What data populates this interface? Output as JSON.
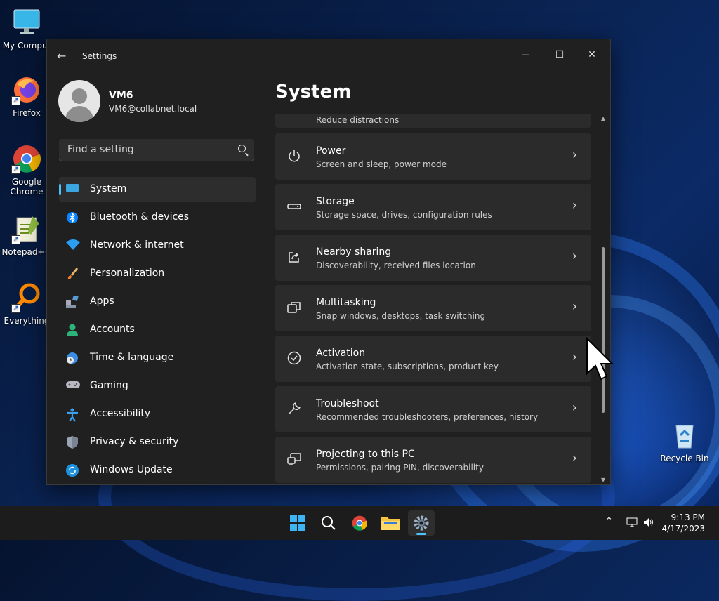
{
  "desktop": {
    "icons": [
      {
        "label": "My Comput"
      },
      {
        "label": "Firefox"
      },
      {
        "label": "Google Chrome"
      },
      {
        "label": "Notepad++"
      },
      {
        "label": "Everything"
      },
      {
        "label": "Recycle Bin"
      }
    ]
  },
  "window": {
    "title": "Settings",
    "back_icon": "←",
    "minimize_icon": "—",
    "maximize_icon": "☐",
    "close_icon": "✕"
  },
  "profile": {
    "name": "VM6",
    "email": "VM6@collabnet.local"
  },
  "search": {
    "placeholder": "Find a setting"
  },
  "nav": {
    "items": [
      {
        "label": "System",
        "icon": "system-icon",
        "active": true
      },
      {
        "label": "Bluetooth & devices",
        "icon": "bluetooth-icon"
      },
      {
        "label": "Network & internet",
        "icon": "wifi-icon"
      },
      {
        "label": "Personalization",
        "icon": "brush-icon"
      },
      {
        "label": "Apps",
        "icon": "apps-icon"
      },
      {
        "label": "Accounts",
        "icon": "person-icon"
      },
      {
        "label": "Time & language",
        "icon": "globe-clock-icon"
      },
      {
        "label": "Gaming",
        "icon": "gamepad-icon"
      },
      {
        "label": "Accessibility",
        "icon": "accessibility-icon"
      },
      {
        "label": "Privacy & security",
        "icon": "shield-icon"
      },
      {
        "label": "Windows Update",
        "icon": "update-icon"
      }
    ]
  },
  "main": {
    "title": "System",
    "partial_card_sub": "Reduce distractions",
    "cards": [
      {
        "title": "Power",
        "sub": "Screen and sleep, power mode",
        "icon": "power-icon"
      },
      {
        "title": "Storage",
        "sub": "Storage space, drives, configuration rules",
        "icon": "storage-icon"
      },
      {
        "title": "Nearby sharing",
        "sub": "Discoverability, received files location",
        "icon": "share-icon"
      },
      {
        "title": "Multitasking",
        "sub": "Snap windows, desktops, task switching",
        "icon": "multitasking-icon"
      },
      {
        "title": "Activation",
        "sub": "Activation state, subscriptions, product key",
        "icon": "checkmark-circle-icon"
      },
      {
        "title": "Troubleshoot",
        "sub": "Recommended troubleshooters, preferences, history",
        "icon": "wrench-icon"
      },
      {
        "title": "Projecting to this PC",
        "sub": "Permissions, pairing PIN, discoverability",
        "icon": "projecting-icon"
      }
    ],
    "chevron": "›"
  },
  "taskbar": {
    "time": "9:13 PM",
    "date": "4/17/2023"
  },
  "colors": {
    "accent": "#4cc2ff",
    "window_bg": "#202020",
    "card_bg": "#2b2b2b"
  }
}
